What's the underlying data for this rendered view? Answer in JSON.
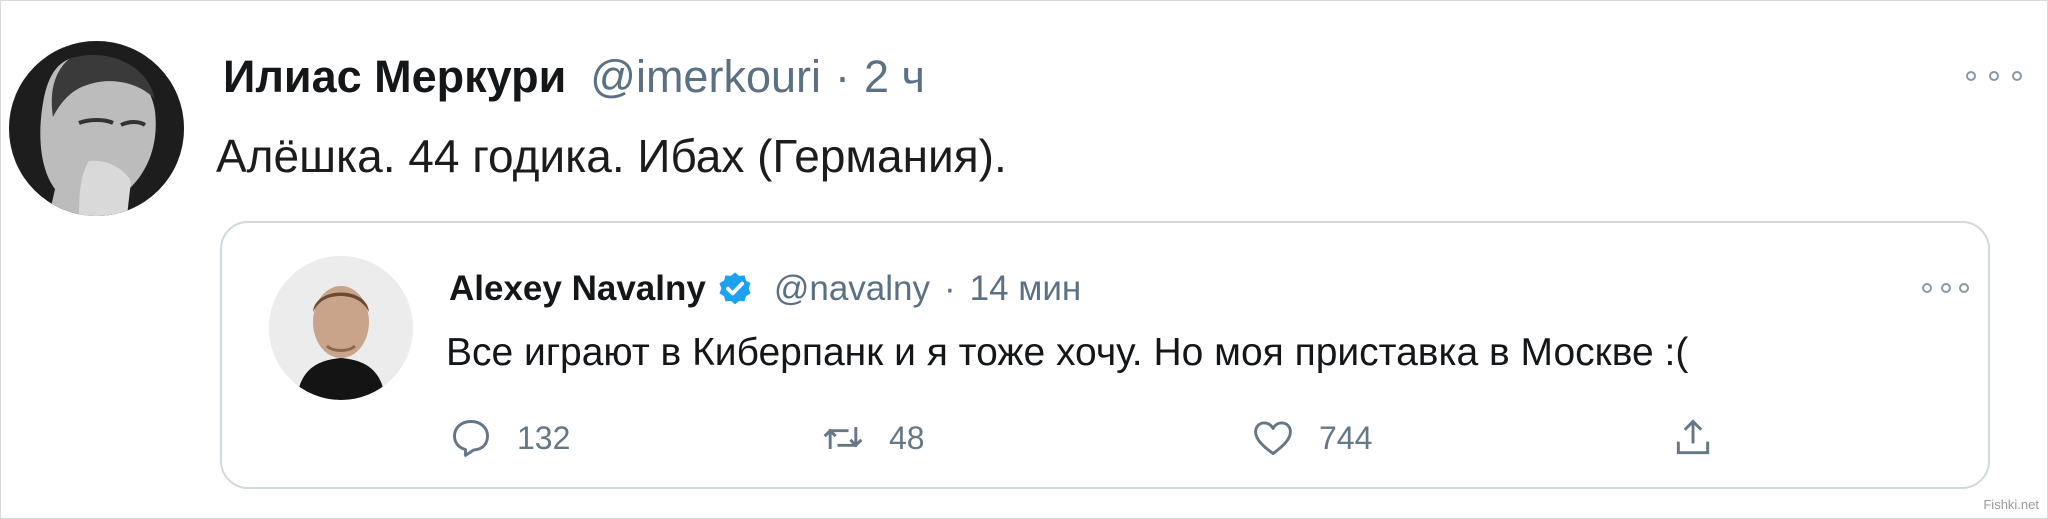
{
  "tweet": {
    "author_name": "Илиас Меркури",
    "author_handle": "@imerkouri",
    "separator": "·",
    "time": "2 ч",
    "text": "Алёшка.  44 годика. Ибах (Германия).",
    "avatar_icon": "avatar-photo",
    "more_icon": "more-options-icon"
  },
  "quoted_tweet": {
    "author_name": "Alexey Navalny",
    "verified_icon": "verified-badge-icon",
    "verified_color": "#1da1f2",
    "author_handle": "@navalny",
    "separator": "·",
    "time": "14 мин",
    "text": "Все играют в Киберпанк и я тоже хочу. Но моя приставка в Москве :(",
    "actions": {
      "reply": {
        "icon": "reply-icon",
        "count": "132"
      },
      "retweet": {
        "icon": "retweet-icon",
        "count": "48"
      },
      "like": {
        "icon": "like-icon",
        "count": "744"
      },
      "share": {
        "icon": "share-icon"
      }
    }
  },
  "watermark": "Fishki.net"
}
